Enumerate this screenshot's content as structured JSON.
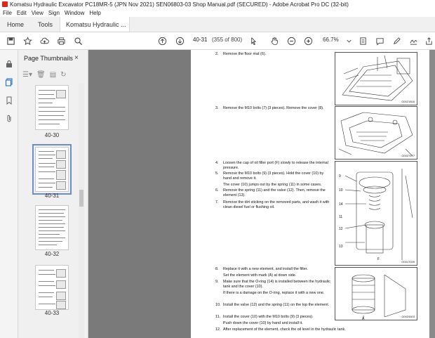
{
  "window": {
    "title": "Komatsu Hydraulic Excavator PC18MR-5 (JPN Nov 2021) SEN06803-03 Shop Manual.pdf (SECURED) - Adobe Acrobat Pro DC (32-bit)"
  },
  "menu": [
    "File",
    "Edit",
    "View",
    "Sign",
    "Window",
    "Help"
  ],
  "tabs": {
    "home": "Home",
    "tools": "Tools",
    "doc": "Komatsu Hydraulic ...",
    "close": "×"
  },
  "toolbar": {
    "page_label": "40-31",
    "page_count": "(355 of 800)",
    "zoom": "66.7%"
  },
  "panel": {
    "title": "Page Thumbnails",
    "close": "×",
    "thumbnails": [
      {
        "label": "40-30",
        "selected": false
      },
      {
        "label": "40-31",
        "selected": true
      },
      {
        "label": "40-32",
        "selected": false
      },
      {
        "label": "40-33",
        "selected": false
      }
    ]
  },
  "document": {
    "steps": [
      {
        "n": "2.",
        "text": "Remove the floor mat (6)."
      },
      {
        "n": "3.",
        "text": "Remove the M10 bolts (7) (3 pieces). Remove the cover (8)."
      },
      {
        "n": "4.",
        "text": "Loosen the cap of oil filler port (F) slowly to release the internal pressure."
      },
      {
        "n": "5.",
        "text": "Remove the M10 bolts (9) (3 pieces). Hold the cover (10) by hand and remove it."
      },
      {
        "n": "",
        "text": "The cover (10) jumps out by the spring (11) in some cases."
      },
      {
        "n": "6.",
        "text": "Remove the spring (11) and the valve (12). Then, remove the element (13)."
      },
      {
        "n": "7.",
        "text": "Remove the dirt sticking on the removed parts, and wash it with clean diesel fuel or flushing oil."
      },
      {
        "n": "8.",
        "text": "Replace it with a new element, and install the filter."
      },
      {
        "n": "",
        "text": "Set the element with mark (A) at down side."
      },
      {
        "n": "9.",
        "text": "Make sure that the O-ring (14) is installed between the hydraulic tank and the cover (10)."
      },
      {
        "n": "",
        "text": "If there is a damage on the O-ring, replace it with a new one."
      },
      {
        "n": "10.",
        "text": "Install the valve (12) and the spring (11) on the top the element."
      },
      {
        "n": "11.",
        "text": "Install the cover (10) with the M10 bolts (9) (3 pieces)."
      },
      {
        "n": "",
        "text": "Push down the cover (10) by hand and install it."
      },
      {
        "n": "12.",
        "text": "After replacement of the element, check the oil level in the hydraulic tank."
      }
    ],
    "figures": [
      {
        "id": "G0021818"
      },
      {
        "id": "G0027477"
      },
      {
        "id": "G0017039",
        "labels": [
          "9",
          "10",
          "14",
          "11",
          "12",
          "13",
          "F"
        ]
      },
      {
        "id": "G0024503",
        "labels": [
          "A"
        ]
      }
    ]
  }
}
